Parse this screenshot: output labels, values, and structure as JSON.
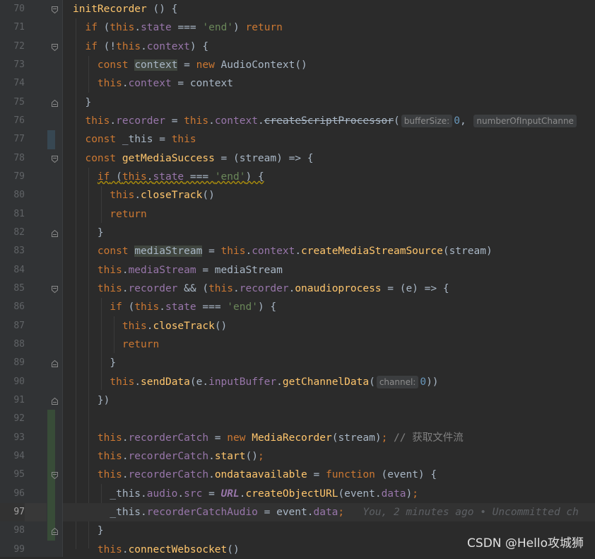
{
  "line_numbers": [
    "70",
    "71",
    "72",
    "73",
    "74",
    "75",
    "76",
    "77",
    "78",
    "79",
    "80",
    "81",
    "82",
    "83",
    "84",
    "85",
    "86",
    "87",
    "88",
    "89",
    "90",
    "91",
    "92",
    "93",
    "94",
    "95",
    "96",
    "97",
    "98",
    "99"
  ],
  "current_line": "97",
  "hints": {
    "buffer_size": "bufferSize:",
    "number_of_input_channels": "numberOfInputChanne",
    "channel": "channel:"
  },
  "comment_text": "// 获取文件流",
  "blame_text": "You, 2 minutes ago • Uncommitted ch",
  "watermark": "CSDN @Hello攻城狮"
}
